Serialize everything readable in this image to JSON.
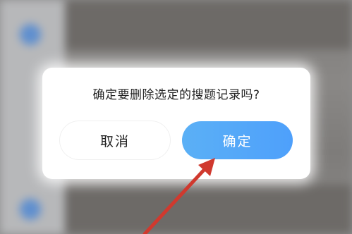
{
  "dialog": {
    "message": "确定要删除选定的搜题记录吗?",
    "cancel_label": "取消",
    "confirm_label": "确定"
  },
  "colors": {
    "confirm_button": "#4ea0fb",
    "arrow": "#d0392e"
  },
  "annotation": {
    "icon": "red-arrow-pointer"
  }
}
